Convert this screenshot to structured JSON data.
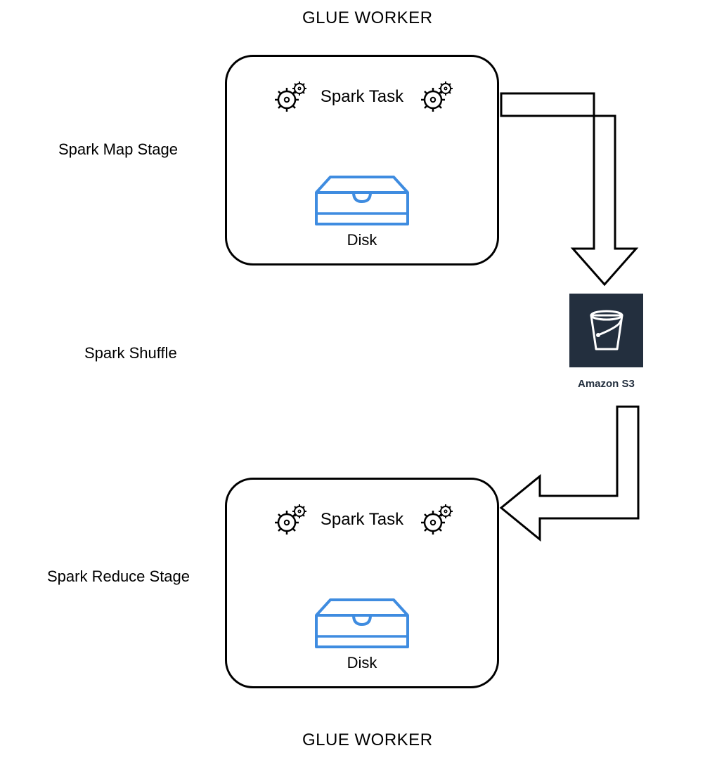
{
  "header_top": "GLUE WORKER",
  "header_bottom": "GLUE WORKER",
  "stage_map": "Spark Map Stage",
  "stage_shuffle": "Spark Shuffle",
  "stage_reduce": "Spark Reduce Stage",
  "task_label_top": "Spark Task",
  "task_label_bottom": "Spark Task",
  "disk_label_top": "Disk",
  "disk_label_bottom": "Disk",
  "s3_label": "Amazon S3",
  "colors": {
    "disk_stroke": "#3f8ce0",
    "s3_bg": "#232f3e"
  }
}
